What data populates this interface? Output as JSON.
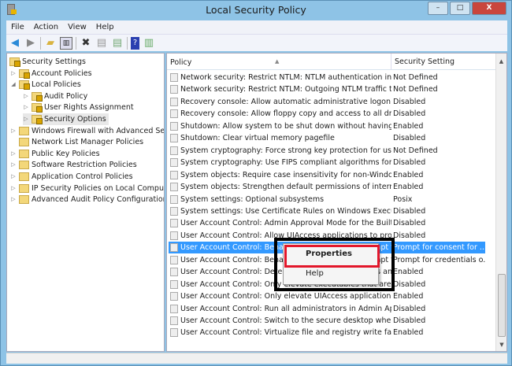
{
  "window": {
    "title": "Local Security Policy",
    "minimize": "–",
    "maximize": "□",
    "close": "X"
  },
  "menu": [
    "File",
    "Action",
    "View",
    "Help"
  ],
  "toolbar": [
    "back-icon",
    "forward-icon",
    "up-folder-icon",
    "show-hide-tree-icon",
    "delete-icon",
    "properties-icon",
    "export-icon",
    "help-icon",
    "show-action-pane-icon"
  ],
  "tree": [
    {
      "label": "Security Settings",
      "level": 0
    },
    {
      "label": "Account Policies",
      "level": 1
    },
    {
      "label": "Local Policies",
      "level": 1
    },
    {
      "label": "Audit Policy",
      "level": 2
    },
    {
      "label": "User Rights Assignment",
      "level": 2
    },
    {
      "label": "Security Options",
      "level": 2
    },
    {
      "label": "Windows Firewall with Advanced Security",
      "level": 1
    },
    {
      "label": "Network List Manager Policies",
      "level": 1
    },
    {
      "label": "Public Key Policies",
      "level": 1
    },
    {
      "label": "Software Restriction Policies",
      "level": 1
    },
    {
      "label": "Application Control Policies",
      "level": 1
    },
    {
      "label": "IP Security Policies on Local Computer",
      "level": 1
    },
    {
      "label": "Advanced Audit Policy Configuration",
      "level": 1
    }
  ],
  "table": {
    "headers": {
      "policy": "Policy",
      "setting": "Security Setting"
    },
    "rows": [
      {
        "policy": "Network security: Restrict NTLM: NTLM authentication in th...",
        "setting": "Not Defined"
      },
      {
        "policy": "Network security: Restrict NTLM: Outgoing NTLM traffic to ...",
        "setting": "Not Defined"
      },
      {
        "policy": "Recovery console: Allow automatic administrative logon",
        "setting": "Disabled"
      },
      {
        "policy": "Recovery console: Allow floppy copy and access to all drives...",
        "setting": "Disabled"
      },
      {
        "policy": "Shutdown: Allow system to be shut down without having to...",
        "setting": "Enabled"
      },
      {
        "policy": "Shutdown: Clear virtual memory pagefile",
        "setting": "Disabled"
      },
      {
        "policy": "System cryptography: Force strong key protection for user k...",
        "setting": "Not Defined"
      },
      {
        "policy": "System cryptography: Use FIPS compliant algorithms for en...",
        "setting": "Disabled"
      },
      {
        "policy": "System objects: Require case insensitivity for non-Windows ...",
        "setting": "Enabled"
      },
      {
        "policy": "System objects: Strengthen default permissions of internal s...",
        "setting": "Enabled"
      },
      {
        "policy": "System settings: Optional subsystems",
        "setting": "Posix"
      },
      {
        "policy": "System settings: Use Certificate Rules on Windows Executabl...",
        "setting": "Disabled"
      },
      {
        "policy": "User Account Control: Admin Approval Mode for the Built-i...",
        "setting": "Disabled"
      },
      {
        "policy": "User Account Control: Allow UIAccess applications to prom...",
        "setting": "Disabled"
      },
      {
        "policy": "User Account Control: Behavior of the elevation prompt fo...",
        "setting": "Prompt for consent for ..."
      },
      {
        "policy": "User Account Control: Behavior of the elevation prompt fo...",
        "setting": "Prompt for credentials o..."
      },
      {
        "policy": "User Account Control: Detect application installations an...",
        "setting": "Enabled"
      },
      {
        "policy": "User Account Control: Only elevate executables that are sign...",
        "setting": "Disabled"
      },
      {
        "policy": "User Account Control: Only elevate UIAccess applications th...",
        "setting": "Enabled"
      },
      {
        "policy": "User Account Control: Run all administrators in Admin Appr...",
        "setting": "Disabled"
      },
      {
        "policy": "User Account Control: Switch to the secure desktop when pr...",
        "setting": "Disabled"
      },
      {
        "policy": "User Account Control: Virtualize file and registry write failure...",
        "setting": "Enabled"
      }
    ]
  },
  "selected_row": 14,
  "context_menu": {
    "properties": "Properties",
    "help": "Help"
  },
  "colors": {
    "selection": "#3399ff",
    "highlight_red": "#e3172b"
  }
}
